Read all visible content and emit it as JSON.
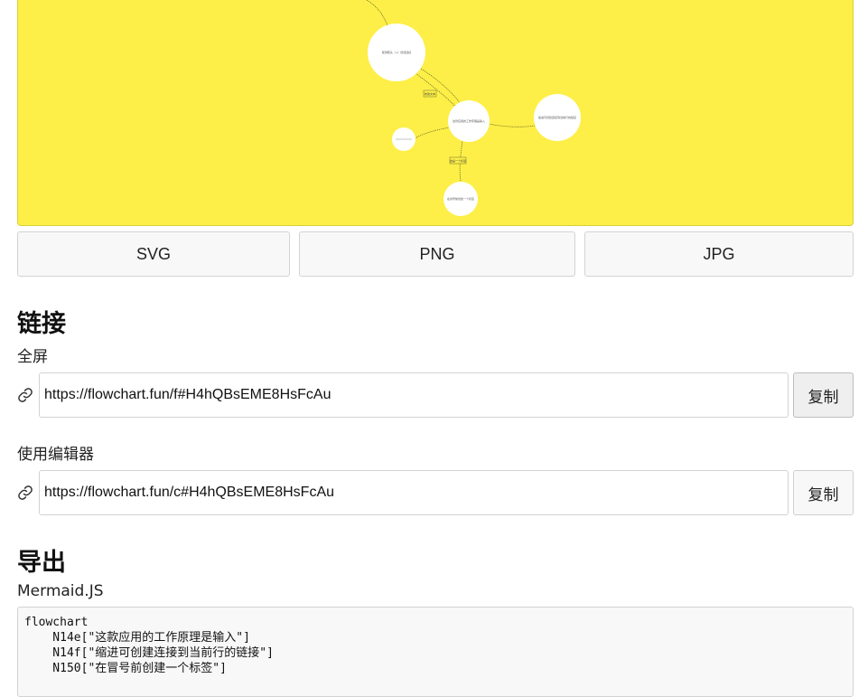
{
  "chart": {
    "nodes": [
      {
        "id": "n1",
        "label": "使用箭头（→）创建连接"
      },
      {
        "id": "n2",
        "label": "这款应用的工作原理是输入"
      },
      {
        "id": "n3",
        "label": "缩进可创建连接到当前行的链接"
      },
      {
        "id": "n4",
        "label": "在冒号前创建一个标签"
      },
      {
        "id": "n5",
        "label": ""
      },
      {
        "id": "n6",
        "label": ""
      }
    ],
    "edge_labels": [
      "新建文本",
      "这是一个标签"
    ]
  },
  "export_buttons": {
    "svg": "SVG",
    "png": "PNG",
    "jpg": "JPG"
  },
  "links": {
    "heading": "链接",
    "fullscreen_label": "全屏",
    "fullscreen_url": "https://flowchart.fun/f#H4hQBsEME8HsFcAu",
    "editor_label": "使用编辑器",
    "editor_url": "https://flowchart.fun/c#H4hQBsEME8HsFcAu",
    "copy_label": "复制"
  },
  "export": {
    "heading": "导出",
    "mermaid_label": "Mermaid.JS",
    "code_lines": [
      "flowchart",
      "    N14e[\"这款应用的工作原理是输入\"]",
      "    N14f[\"缩进可创建连接到当前行的链接\"]",
      "    N150[\"在冒号前创建一个标签\"]"
    ]
  },
  "colors": {
    "canvas_bg": "#fdef47",
    "node_fill": "#ffffff",
    "edge": "#6b6b2a"
  },
  "icons": {
    "link": "link-icon"
  }
}
